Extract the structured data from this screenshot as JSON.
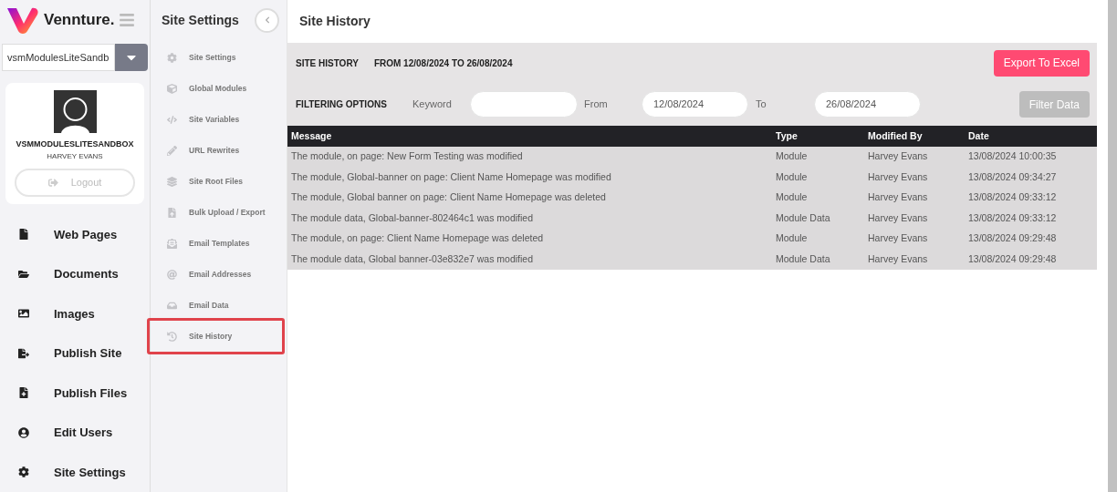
{
  "brand": {
    "name": "Vennture."
  },
  "site_select": {
    "value": "vsmModulesLiteSandb"
  },
  "profile": {
    "site": "VSMMODULESLITESANDBOX",
    "user": "HARVEY EVANS",
    "logout": "Logout"
  },
  "nav": [
    {
      "label": "Web Pages"
    },
    {
      "label": "Documents"
    },
    {
      "label": "Images"
    },
    {
      "label": "Publish Site"
    },
    {
      "label": "Publish Files"
    },
    {
      "label": "Edit Users"
    },
    {
      "label": "Site Settings"
    }
  ],
  "submenu": {
    "title": "Site Settings",
    "items": [
      {
        "label": "Site Settings",
        "selected": false
      },
      {
        "label": "Global Modules",
        "selected": false
      },
      {
        "label": "Site Variables",
        "selected": false
      },
      {
        "label": "URL Rewrites",
        "selected": false
      },
      {
        "label": "Site Root Files",
        "selected": false
      },
      {
        "label": "Bulk Upload / Export",
        "selected": false
      },
      {
        "label": "Email Templates",
        "selected": false
      },
      {
        "label": "Email Addresses",
        "selected": false
      },
      {
        "label": "Email Data",
        "selected": false
      },
      {
        "label": "Site History",
        "selected": true
      }
    ]
  },
  "page": {
    "title": "Site History",
    "section": "SITE HISTORY",
    "range": "FROM 12/08/2024 TO 26/08/2024",
    "export": "Export To Excel",
    "filter": {
      "title": "FILTERING OPTIONS",
      "keyword_label": "Keyword",
      "from_label": "From",
      "from_value": "12/08/2024",
      "to_label": "To",
      "to_value": "26/08/2024",
      "button": "Filter Data"
    }
  },
  "table": {
    "columns": [
      "Message",
      "Type",
      "Modified By",
      "Date"
    ],
    "rows": [
      [
        "The module, on page: New Form Testing was modified",
        "Module",
        "Harvey Evans",
        "13/08/2024 10:00:35"
      ],
      [
        "The module, Global-banner on page: Client Name Homepage was modified",
        "Module",
        "Harvey Evans",
        "13/08/2024 09:34:27"
      ],
      [
        "The module, Global banner on page: Client Name Homepage was deleted",
        "Module",
        "Harvey Evans",
        "13/08/2024 09:33:12"
      ],
      [
        "The module data, Global-banner-802464c1 was modified",
        "Module Data",
        "Harvey Evans",
        "13/08/2024 09:33:12"
      ],
      [
        "The module, on page: Client Name Homepage was deleted",
        "Module",
        "Harvey Evans",
        "13/08/2024 09:29:48"
      ],
      [
        "The module data, Global banner-03e832e7 was modified",
        "Module Data",
        "Harvey Evans",
        "13/08/2024 09:29:48"
      ]
    ]
  }
}
